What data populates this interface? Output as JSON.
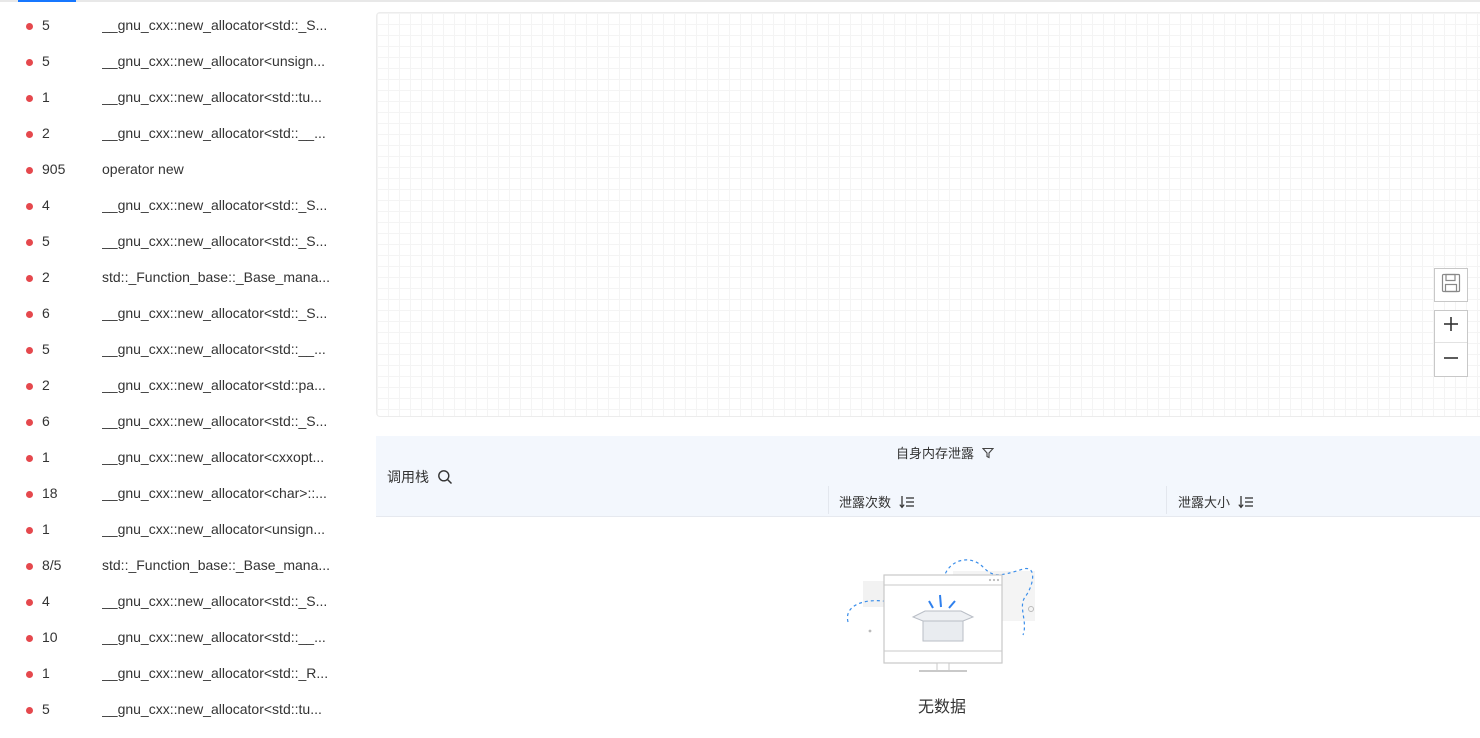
{
  "list_items": [
    {
      "count": "5",
      "name": "__gnu_cxx::new_allocator<std::_S..."
    },
    {
      "count": "5",
      "name": "__gnu_cxx::new_allocator<unsign..."
    },
    {
      "count": "1",
      "name": "__gnu_cxx::new_allocator<std::tu..."
    },
    {
      "count": "2",
      "name": "__gnu_cxx::new_allocator<std::__..."
    },
    {
      "count": "905",
      "name": "operator new"
    },
    {
      "count": "4",
      "name": "__gnu_cxx::new_allocator<std::_S..."
    },
    {
      "count": "5",
      "name": "__gnu_cxx::new_allocator<std::_S..."
    },
    {
      "count": "2",
      "name": "std::_Function_base::_Base_mana..."
    },
    {
      "count": "6",
      "name": "__gnu_cxx::new_allocator<std::_S..."
    },
    {
      "count": "5",
      "name": "__gnu_cxx::new_allocator<std::__..."
    },
    {
      "count": "2",
      "name": "__gnu_cxx::new_allocator<std::pa..."
    },
    {
      "count": "6",
      "name": "__gnu_cxx::new_allocator<std::_S..."
    },
    {
      "count": "1",
      "name": "__gnu_cxx::new_allocator<cxxopt..."
    },
    {
      "count": "18",
      "name": "__gnu_cxx::new_allocator<char>::..."
    },
    {
      "count": "1",
      "name": "__gnu_cxx::new_allocator<unsign..."
    },
    {
      "count": "8/5",
      "name": "std::_Function_base::_Base_mana..."
    },
    {
      "count": "4",
      "name": "__gnu_cxx::new_allocator<std::_S..."
    },
    {
      "count": "10",
      "name": "__gnu_cxx::new_allocator<std::__..."
    },
    {
      "count": "1",
      "name": "__gnu_cxx::new_allocator<std::_R..."
    },
    {
      "count": "5",
      "name": "__gnu_cxx::new_allocator<std::tu..."
    }
  ],
  "table": {
    "callstack_label": "调用栈",
    "self_leak_label": "自身内存泄露",
    "leak_count_label": "泄露次数",
    "leak_size_label": "泄露大小",
    "empty_text": "无数据"
  },
  "icons": {
    "save": "save-icon",
    "zoom_in": "plus-icon",
    "zoom_out": "minus-icon",
    "search": "search-icon",
    "filter": "filter-icon",
    "sort": "sort-icon"
  },
  "colors": {
    "dot": "#e5484d",
    "accent": "#1677ff",
    "header_bg": "#f3f7fd"
  }
}
